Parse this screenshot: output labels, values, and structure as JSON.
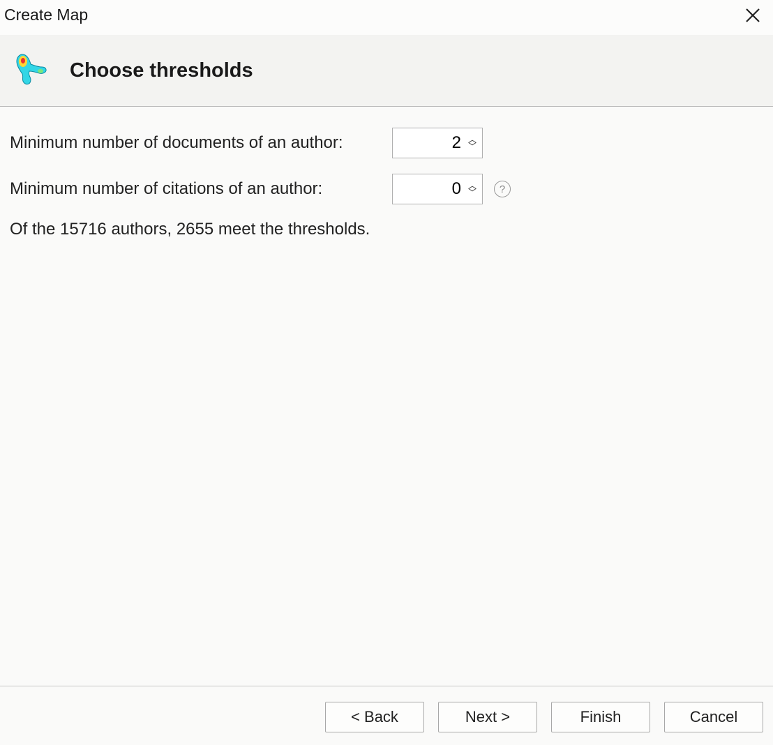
{
  "titlebar": {
    "title": "Create Map"
  },
  "header": {
    "title": "Choose thresholds"
  },
  "form": {
    "min_docs_label": "Minimum number of documents of an author:",
    "min_docs_value": "2",
    "min_cites_label": "Minimum number of citations of an author:",
    "min_cites_value": "0",
    "help_glyph": "?"
  },
  "summary": "Of the 15716 authors, 2655 meet the thresholds.",
  "footer": {
    "back": "< Back",
    "next": "Next >",
    "finish": "Finish",
    "cancel": "Cancel"
  }
}
